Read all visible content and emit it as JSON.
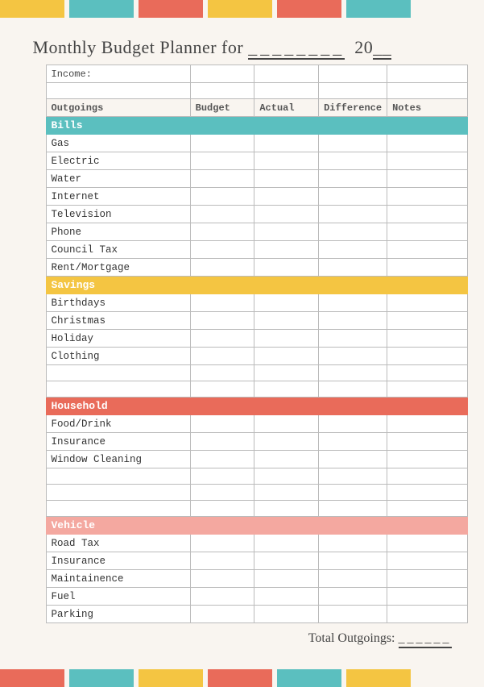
{
  "colors": {
    "bills": "#5bbfbf",
    "savings": "#f4c542",
    "household": "#e96b5a",
    "vehicle": "#f4a8a0",
    "bar1": "#f4c542",
    "bar2": "#5bbfbf",
    "bar3": "#e96b5a"
  },
  "title": {
    "text": "Monthly Budget Planner for",
    "for_line": "________",
    "year_prefix": "20",
    "year_line": "__"
  },
  "table": {
    "income_label": "Income:",
    "headers": {
      "outgoings": "Outgoings",
      "budget": "Budget",
      "actual": "Actual",
      "difference": "Difference",
      "notes": "Notes"
    },
    "categories": {
      "bills": {
        "label": "Bills",
        "items": [
          "Gas",
          "Electric",
          "Water",
          "Internet",
          "Television",
          "Phone",
          "Council Tax",
          "Rent/Mortgage"
        ]
      },
      "savings": {
        "label": "Savings",
        "items": [
          "Birthdays",
          "Christmas",
          "Holiday",
          "Clothing",
          "",
          ""
        ]
      },
      "household": {
        "label": "Household",
        "items": [
          "Food/Drink",
          "Insurance",
          "Window Cleaning",
          "",
          "",
          ""
        ]
      },
      "vehicle": {
        "label": "Vehicle",
        "items": [
          "Road Tax",
          "Insurance",
          "Maintainence",
          "Fuel",
          "Parking"
        ]
      }
    },
    "total_label": "Total Outgoings:",
    "total_line": "______"
  }
}
